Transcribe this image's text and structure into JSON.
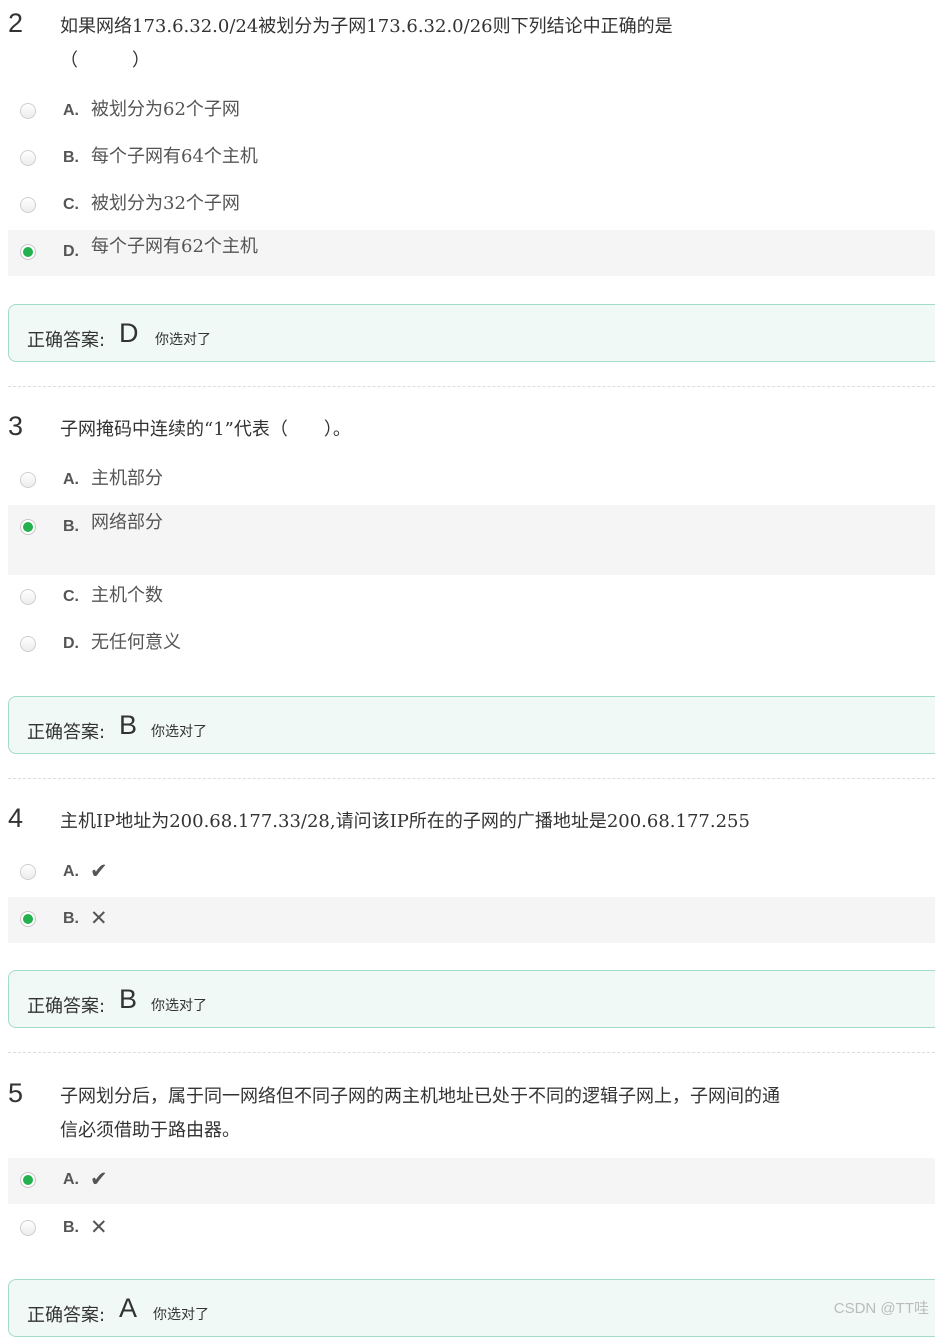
{
  "questions": [
    {
      "number": "2",
      "text": "如果网络173.6.32.0/24被划分为子网173.6.32.0/26则下列结论中正确的是（　　　）",
      "options": [
        {
          "letter": "A.",
          "text": "被划分为62个子网"
        },
        {
          "letter": "B.",
          "text": "每个子网有64个主机"
        },
        {
          "letter": "C.",
          "text": "被划分为32个子网"
        },
        {
          "letter": "D.",
          "text": "每个子网有62个主机"
        }
      ],
      "selected": "D",
      "answer": {
        "label": "正确答案:",
        "value": "D",
        "note": "你选对了"
      }
    },
    {
      "number": "3",
      "text": "子网掩码中连续的“1”代表（　　）。",
      "options": [
        {
          "letter": "A.",
          "text": "主机部分"
        },
        {
          "letter": "B.",
          "text": "网络部分"
        },
        {
          "letter": "C.",
          "text": "主机个数"
        },
        {
          "letter": "D.",
          "text": "无任何意义"
        }
      ],
      "selected": "B",
      "answer": {
        "label": "正确答案:",
        "value": "B",
        "note": "你选对了"
      }
    },
    {
      "number": "4",
      "text": "主机IP地址为200.68.177.33/28,请问该IP所在的子网的广播地址是200.68.177.255",
      "options": [
        {
          "letter": "A.",
          "icon": "check-icon",
          "glyph": "✔"
        },
        {
          "letter": "B.",
          "icon": "cross-icon",
          "glyph": "✕"
        }
      ],
      "selected": "B",
      "answer": {
        "label": "正确答案:",
        "value": "B",
        "note": "你选对了"
      }
    },
    {
      "number": "5",
      "text": "子网划分后，属于同一网络但不同子网的两主机地址已处于不同的逻辑子网上，子网间的通信必须借助于路由器。",
      "options": [
        {
          "letter": "A.",
          "icon": "check-icon",
          "glyph": "✔"
        },
        {
          "letter": "B.",
          "icon": "cross-icon",
          "glyph": "✕"
        }
      ],
      "selected": "A",
      "answer": {
        "label": "正确答案:",
        "value": "A",
        "note": "你选对了"
      }
    }
  ],
  "watermark": "CSDN @TT哇",
  "colors": {
    "selected_radio": "#22b14c",
    "answer_border": "#a5dcc6",
    "answer_background": "#f1f9f7",
    "selected_row": "#f5f5f5"
  }
}
